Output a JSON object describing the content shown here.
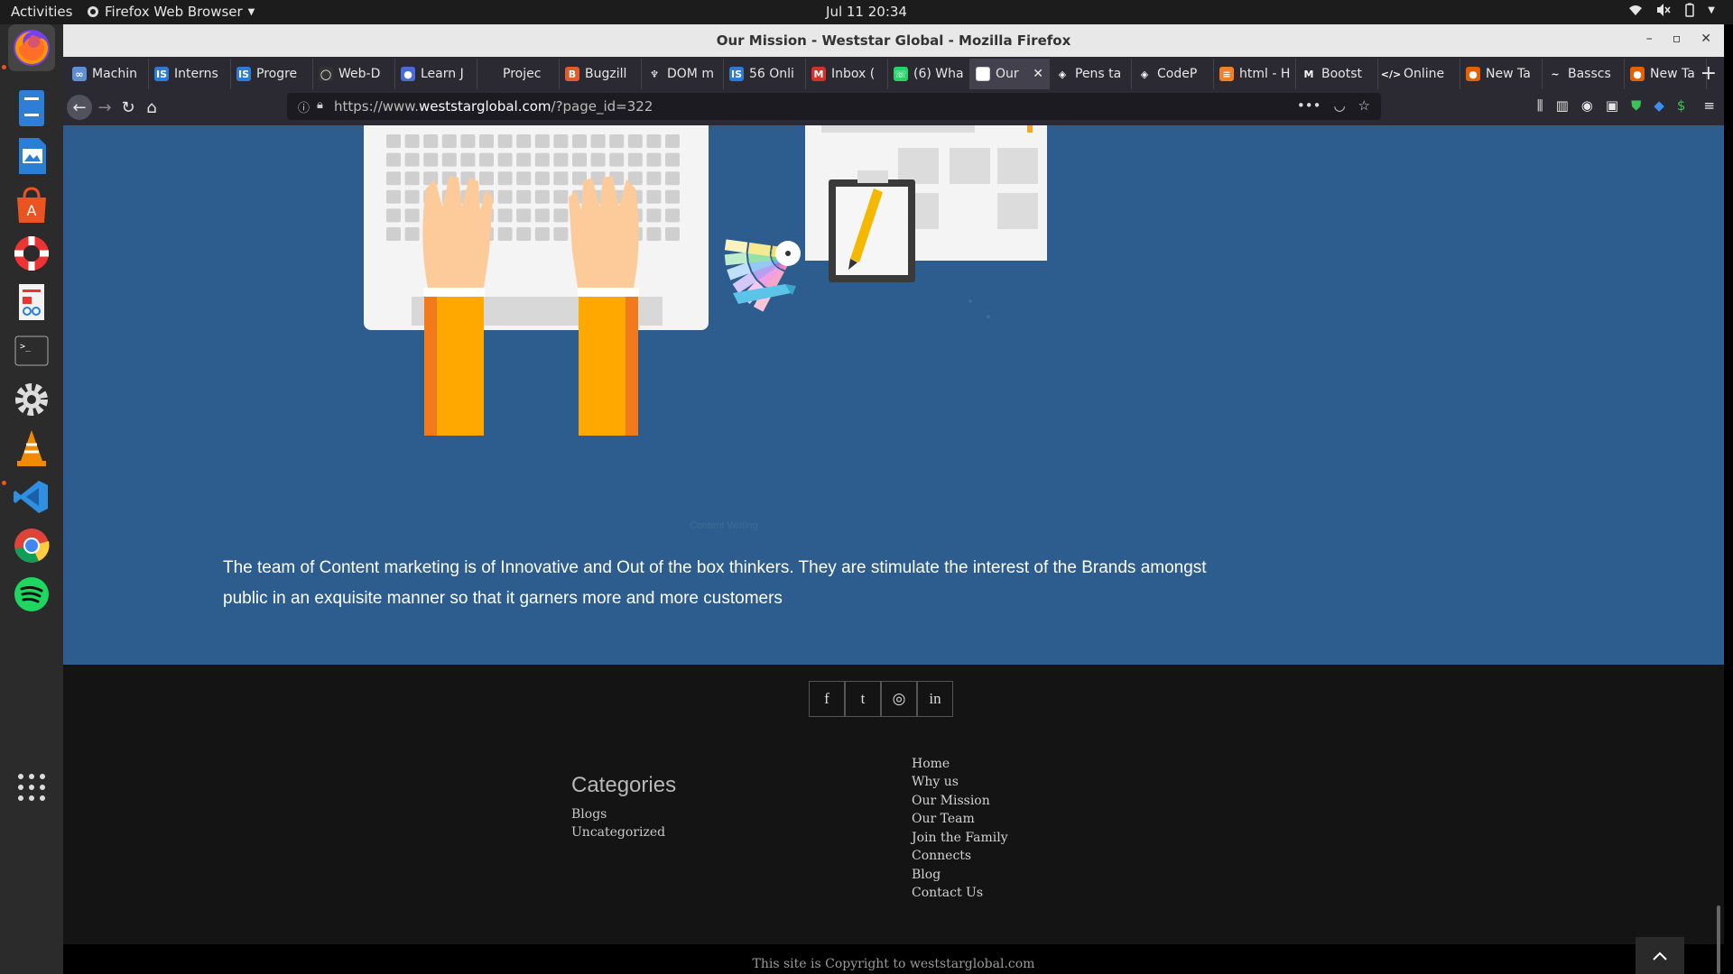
{
  "topbar": {
    "activities": "Activities",
    "app_name": "Firefox Web Browser",
    "clock": "Jul 11  20:34"
  },
  "window": {
    "title": "Our Mission - Weststar Global - Mozilla Firefox"
  },
  "tabs": [
    {
      "label": "Machin",
      "icon": "infinity-icon",
      "color": "#5b8fd6"
    },
    {
      "label": "Interns",
      "icon": "is-icon",
      "color": "#2e7bd6"
    },
    {
      "label": "Progre",
      "icon": "is-icon",
      "color": "#2e7bd6"
    },
    {
      "label": "Web-D",
      "icon": "github-icon",
      "color": "#333333"
    },
    {
      "label": "Learn J",
      "icon": "globe-icon",
      "color": "#4a6cd6"
    },
    {
      "label": "Projec",
      "icon": "blank-icon",
      "color": "#2b2a33"
    },
    {
      "label": "Bugzill",
      "icon": "bugzilla-icon",
      "color": "#e25b2a"
    },
    {
      "label": "DOM m",
      "icon": "mdn-icon",
      "color": "#2b2a33"
    },
    {
      "label": "56 Onli",
      "icon": "is-icon",
      "color": "#2e7bd6"
    },
    {
      "label": "Inbox (",
      "icon": "gmail-icon",
      "color": "#d93025"
    },
    {
      "label": "(6) Wha",
      "icon": "whatsapp-icon",
      "color": "#25d366"
    },
    {
      "label": "Our",
      "icon": "page-icon",
      "color": "#ffffff",
      "current": true
    },
    {
      "label": "Pens ta",
      "icon": "codepen-icon",
      "color": "#2b2a33"
    },
    {
      "label": "CodeP",
      "icon": "codepen-icon",
      "color": "#2b2a33"
    },
    {
      "label": "html - H",
      "icon": "stackoverflow-icon",
      "color": "#f48024"
    },
    {
      "label": "Bootst",
      "icon": "medium-icon",
      "color": "#2b2a33"
    },
    {
      "label": "Online",
      "icon": "code-icon",
      "color": "#2b2a33"
    },
    {
      "label": "New Ta",
      "icon": "firefox-icon",
      "color": "#e66000"
    },
    {
      "label": "Basscs",
      "icon": "wave-icon",
      "color": "#2b2a33"
    },
    {
      "label": "New Ta",
      "icon": "firefox-icon",
      "color": "#e66000"
    }
  ],
  "url": {
    "lead": "https://www.",
    "main": "weststarglobal.com",
    "tail": "/?page_id=322"
  },
  "page": {
    "caption": "Content Writing",
    "body": "The team of Content marketing is of Innovative and Out of the box thinkers. They are stimulate the interest of the Brands amongst public in an exquisite manner so that it garners more and more customers"
  },
  "footer": {
    "social": [
      {
        "name": "facebook",
        "glyph": "f"
      },
      {
        "name": "twitter",
        "glyph": "t"
      },
      {
        "name": "instagram",
        "glyph": "◎"
      },
      {
        "name": "linkedin",
        "glyph": "in"
      }
    ],
    "categories_title": "Categories",
    "categories": [
      "Blogs",
      "Uncategorized"
    ],
    "menu": [
      "Home",
      "Why us",
      "Our Mission",
      "Our Team",
      "Join the Family",
      "Connects",
      "Blog",
      "Contact Us"
    ],
    "copyright": "This site is Copyright to weststarglobal.com"
  },
  "colors": {
    "page_blue": "#2c5d8e",
    "footer_dark": "#141414",
    "accent_orange": "#f5a623"
  }
}
